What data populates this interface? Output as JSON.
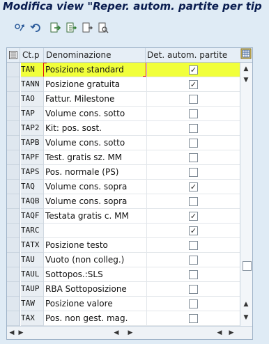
{
  "window": {
    "title": "Modifica view \"Reper. autom. partite per tip"
  },
  "toolbar": {
    "buttons": [
      {
        "name": "display-change-icon"
      },
      {
        "name": "undo-icon"
      },
      {
        "name": "export-icon"
      },
      {
        "name": "move-icon"
      },
      {
        "name": "select-icon"
      },
      {
        "name": "detail-icon"
      }
    ]
  },
  "table": {
    "headers": {
      "code": "Ct.p",
      "description": "Denominazione",
      "auto": "Det. autom. partite"
    },
    "rows": [
      {
        "code": "TAN",
        "description": "Posizione standard",
        "checked": true,
        "highlighted": true
      },
      {
        "code": "TANN",
        "description": "Posizione gratuita",
        "checked": true
      },
      {
        "code": "TAO",
        "description": "Fattur. Milestone",
        "checked": false
      },
      {
        "code": "TAP",
        "description": "Volume cons. sotto",
        "checked": false
      },
      {
        "code": "TAP2",
        "description": "Kit: pos. sost.",
        "checked": false
      },
      {
        "code": "TAPB",
        "description": "Volume cons. sotto",
        "checked": false
      },
      {
        "code": "TAPF",
        "description": "Test. gratis sz. MM",
        "checked": false
      },
      {
        "code": "TAPS",
        "description": "Pos. normale (PS)",
        "checked": false
      },
      {
        "code": "TAQ",
        "description": "Volume cons. sopra",
        "checked": true
      },
      {
        "code": "TAQB",
        "description": "Volume cons. sopra",
        "checked": false
      },
      {
        "code": "TAQF",
        "description": "Testata gratis c. MM",
        "checked": true
      },
      {
        "code": "TARC",
        "description": "",
        "checked": true
      },
      {
        "code": "TATX",
        "description": "Posizione testo",
        "checked": false
      },
      {
        "code": "TAU",
        "description": "Vuoto (non colleg.)",
        "checked": false
      },
      {
        "code": "TAUL",
        "description": "Sottopos.:SLS",
        "checked": false
      },
      {
        "code": "TAUP",
        "description": "RBA Sottoposizione",
        "checked": false
      },
      {
        "code": "TAW",
        "description": "Posizione valore",
        "checked": false
      },
      {
        "code": "TAX",
        "description": "Pos. non gest. mag.",
        "checked": false
      }
    ]
  }
}
